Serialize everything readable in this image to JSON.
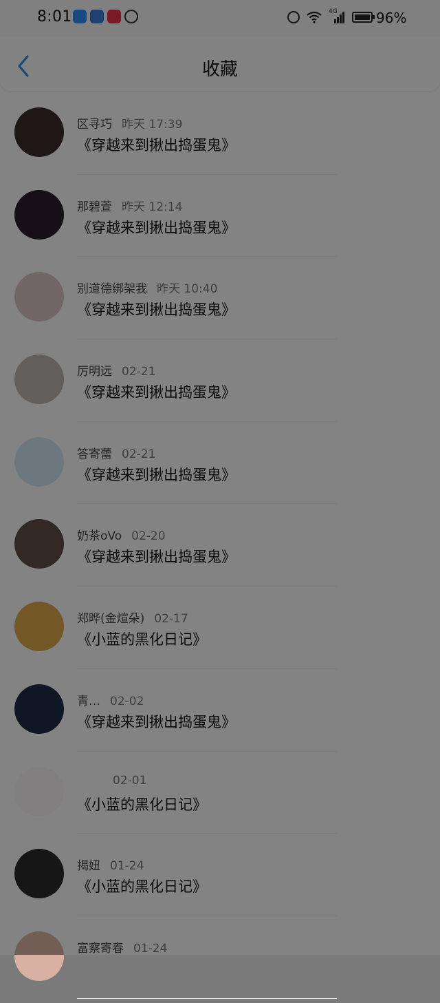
{
  "status_bar": {
    "time": "8:01",
    "battery_percent": "96%",
    "network_label": "4G",
    "app_icons": [
      "weather-app-icon",
      "bulb-app-icon",
      "video-app-icon",
      "clock-app-icon"
    ]
  },
  "header": {
    "title": "收藏",
    "back_icon": "chevron-left-icon"
  },
  "items": [
    {
      "name": "区寻巧",
      "date": "昨天 17:39",
      "title": "《穿越来到揪出捣蛋鬼》",
      "avatar_color": "#3b2a2a"
    },
    {
      "name": "那碧萱",
      "date": "昨天 12:14",
      "title": "《穿越来到揪出捣蛋鬼》",
      "avatar_color": "#2b1e2e"
    },
    {
      "name": "别道德绑架我",
      "date": "昨天 10:40",
      "title": "《穿越来到揪出捣蛋鬼》",
      "avatar_color": "#d8c3c3"
    },
    {
      "name": "厉明远",
      "date": "02-21",
      "title": "《穿越来到揪出捣蛋鬼》",
      "avatar_color": "#b8b1ad"
    },
    {
      "name": "答寄蕾",
      "date": "02-21",
      "title": "《穿越来到揪出捣蛋鬼》",
      "avatar_color": "#cfe3ee"
    },
    {
      "name": "奶茶oVo",
      "date": "02-20",
      "title": "《穿越来到揪出捣蛋鬼》",
      "avatar_color": "#5e4a42"
    },
    {
      "name": "郑晔(金煊朵)",
      "date": "02-17",
      "title": "《小蓝的黑化日记》",
      "avatar_color": "#d9a54a"
    },
    {
      "name": "青…",
      "date": "02-02",
      "title": "《穿越来到揪出捣蛋鬼》",
      "avatar_color": "#1e2b44"
    },
    {
      "name": "",
      "date": "02-01",
      "title": "《小蓝的黑化日记》",
      "avatar_color": "#f3f0f2"
    },
    {
      "name": "揭妞",
      "date": "01-24",
      "title": "《小蓝的黑化日记》",
      "avatar_color": "#2a2a2a"
    },
    {
      "name": "富察寄春",
      "date": "01-24",
      "title": "",
      "avatar_color": "#d9b1a2"
    }
  ]
}
